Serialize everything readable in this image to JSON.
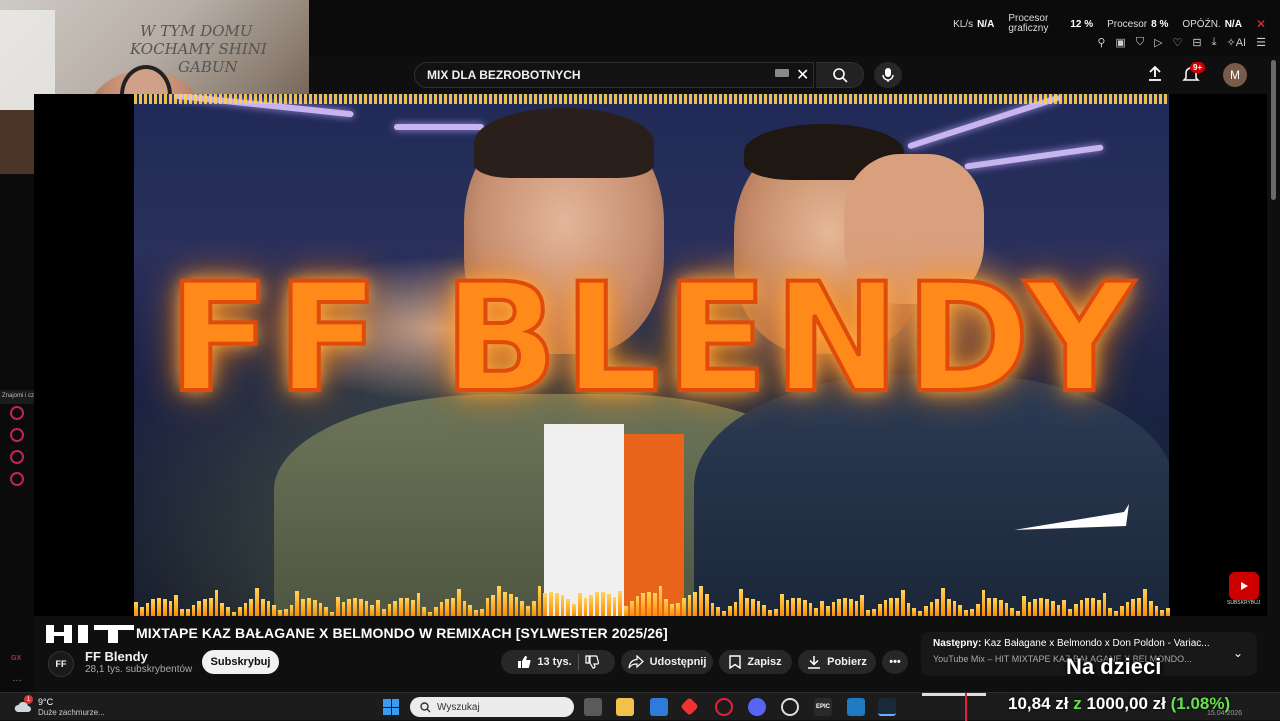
{
  "overlay": {
    "stats": [
      {
        "label": "KL/s",
        "value": "N/A"
      },
      {
        "label": "Procesor graficzny",
        "value": "12 %"
      },
      {
        "label": "Procesor",
        "value": "8 %"
      },
      {
        "label": "OPÓŹN.",
        "value": "N/A"
      }
    ],
    "ai_label": "AI"
  },
  "webcam": {
    "wall_text_1": "W TYM DOMU",
    "wall_text_2": "KOCHAMY SHINI",
    "wall_text_3": "GABUN"
  },
  "youtube_header": {
    "search_value": "MIX DLA BEZROBOTNYCH",
    "notification_count": "9+",
    "avatar_letter": "M"
  },
  "left_sidebar": {
    "tooltip": "Znajomi i czat"
  },
  "thumbnail": {
    "overlay_title": "FF BLENDY",
    "watermark_text": "SUBSKRYBUJ"
  },
  "video": {
    "title": "MIXTAPE KAZ BAŁAGANE X BELMONDO W REMIXACH [SYLWESTER 2025/26]",
    "channel_initials": "FF",
    "channel_name": "FF Blendy",
    "subscribers": "28,1 tys. subskrybentów",
    "subscribe_label": "Subskrybuj",
    "likes": "13 tys.",
    "share_label": "Udostępnij",
    "save_label": "Zapisz",
    "download_label": "Pobierz"
  },
  "next_up": {
    "prefix": "Następny:",
    "title": "Kaz Bałagane x Belmondo x Don Poldon - Variac...",
    "subtitle": "YouTube Mix – HIT MIXTAPE KAZ BAŁAGANE X BELMONDO..."
  },
  "overlay_caption": "Na dzieci",
  "taskbar": {
    "weather_badge": "1",
    "temperature": "9°C",
    "weather_desc": "Duże zachmurze...",
    "search_placeholder": "Wyszukaj",
    "price_prefix": "10,84 zł",
    "price_sep": "z",
    "price_main": "1000,00 zł",
    "price_pct": "(1.08%)",
    "date": "15.04.2026"
  },
  "colors": {
    "accent_red": "#cc0000",
    "title_orange": "#ff8a1a",
    "stock_green": "#66e04a"
  }
}
